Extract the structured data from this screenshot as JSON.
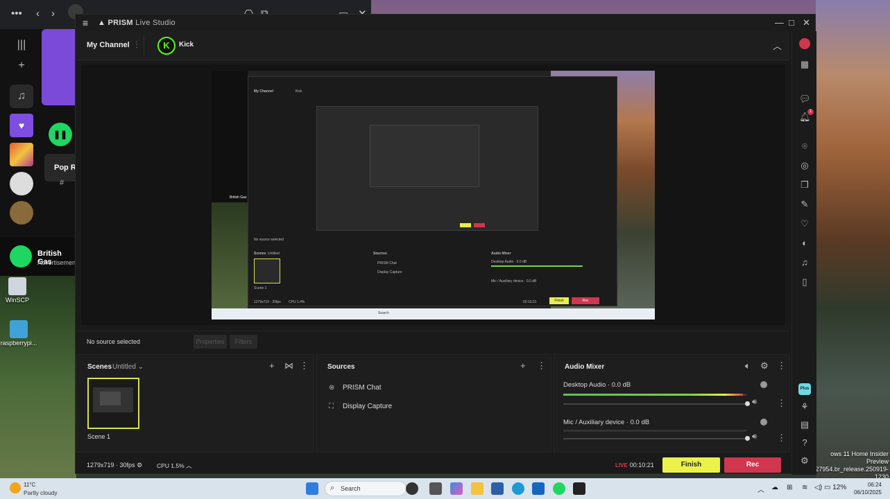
{
  "desktop": {
    "icons": [
      {
        "label": "WinSCP"
      },
      {
        "label": "raspberrypi..."
      }
    ],
    "windows_notice": {
      "line1": "ows 11 Home Insider Preview",
      "line2": "27954.br_release.250919-1230"
    }
  },
  "spotify": {
    "card_text": "Pop Ro",
    "hash": "#",
    "ad": {
      "title": "British Gas",
      "subtitle": "Advertisemen"
    }
  },
  "prism": {
    "app_name": "PRISM",
    "app_name_suffix": "Live Studio",
    "my_channel": "My Channel",
    "channel_name": "Kick",
    "no_source": "No source selected",
    "properties_btn": "Properties",
    "filters_btn": "Filters",
    "scenes": {
      "title": "Scenes",
      "collection": "Untitled",
      "items": [
        {
          "label": "Scene 1"
        }
      ]
    },
    "sources": {
      "title": "Sources",
      "items": [
        {
          "label": "PRISM Chat",
          "icon": "chat-source-icon"
        },
        {
          "label": "Display Capture",
          "icon": "display-capture-icon"
        }
      ]
    },
    "mixer": {
      "title": "Audio Mixer",
      "channels": [
        {
          "label": "Desktop Audio",
          "db": "0.0 dB",
          "level": 0.98
        },
        {
          "label": "Mic / Auxiliary device",
          "db": "0.0 dB",
          "level": 0.0
        }
      ]
    },
    "status": {
      "resolution": "1279x719 · 30fps",
      "cpu": "CPU 1.5%",
      "live_tag": "LIVE",
      "timer": "00:10:21"
    },
    "finish_btn": "Finish",
    "rec_btn": "Rec",
    "sidebar": {
      "notification_count": "1",
      "plus_label": "Plus"
    },
    "preview": {
      "my_channel": "My Channel",
      "channel": "Kick",
      "no_source": "No source selected",
      "scenes": "Scenes",
      "untitled": "Untitled",
      "sources": "Sources",
      "chat": "PRISM Chat",
      "capture": "Display Capture",
      "mixer": "Audio Mixer",
      "desktop_audio": "Desktop Audio · 0.0 dB",
      "mic": "Mic / Auxiliary device · 0.0 dB",
      "scene1": "Scene 1",
      "res": "1279x719 · 30fps",
      "cpu": "CPU 1.4%",
      "timer": "00:10:21",
      "finish": "Finish",
      "rec": "Rec",
      "british": "British Gas",
      "search": "Search"
    }
  },
  "taskbar": {
    "weather_temp": "11°C",
    "weather_desc": "Partly cloudy",
    "search_placeholder": "Search",
    "battery": "12%",
    "time": "06:24",
    "date": "06/10/2025"
  },
  "colors": {
    "accent_yellow": "#ecf24a",
    "rec_red": "#d0364e",
    "kick_green": "#53fc18",
    "meter_green": "#7bd34a"
  }
}
